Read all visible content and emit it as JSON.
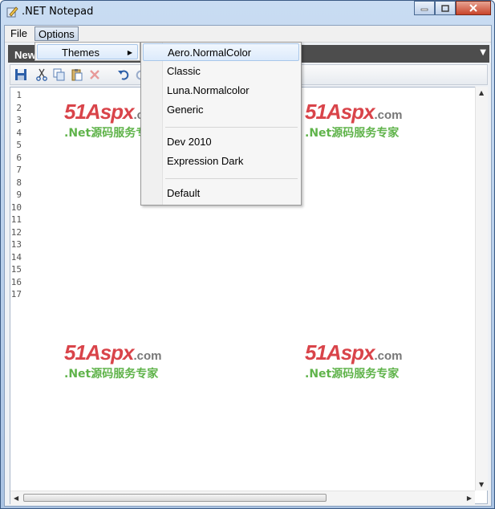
{
  "window": {
    "title": ".NET Notepad"
  },
  "menu": {
    "file": "File",
    "options": "Options"
  },
  "document_tab": {
    "label": "New"
  },
  "options_menu": {
    "themes_label": "Themes"
  },
  "themes_submenu": {
    "items": [
      "Aero.NormalColor",
      "Classic",
      "Luna.Normalcolor",
      "Generic",
      "Dev 2010",
      "Expression Dark",
      "Default"
    ]
  },
  "editor": {
    "line_numbers": [
      "1",
      "2",
      "3",
      "4",
      "5",
      "6",
      "7",
      "8",
      "9",
      "10",
      "11",
      "12",
      "13",
      "14",
      "15",
      "16",
      "17"
    ]
  },
  "watermark": {
    "logo": "51Aspx",
    "domain": ".com",
    "tagline": ".Net源码服务专家"
  },
  "colors": {
    "keyword": "#1a1aa6",
    "keyword_alt": "#a31515",
    "tab_strip": "#4d4d4d",
    "highlight": "#dceafb"
  }
}
